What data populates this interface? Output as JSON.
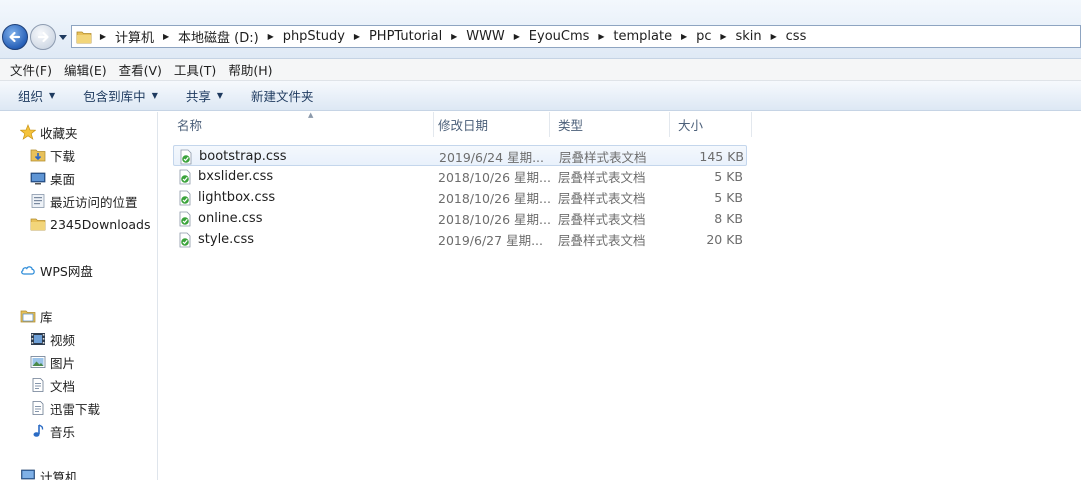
{
  "address_bar": {
    "crumbs": [
      "计算机",
      "本地磁盘 (D:)",
      "phpStudy",
      "PHPTutorial",
      "WWW",
      "EyouCms",
      "template",
      "pc",
      "skin",
      "css"
    ]
  },
  "menu": {
    "items": [
      "文件(F)",
      "编辑(E)",
      "查看(V)",
      "工具(T)",
      "帮助(H)"
    ]
  },
  "toolbar": {
    "organize": "组织",
    "include_library": "包含到库中",
    "share": "共享",
    "new_folder": "新建文件夹"
  },
  "nav": {
    "favorites": "收藏夹",
    "favorites_items": [
      "下载",
      "桌面",
      "最近访问的位置",
      "2345Downloads"
    ],
    "wps": "WPS网盘",
    "library": "库",
    "library_items": [
      "视频",
      "图片",
      "文档",
      "迅雷下载",
      "音乐"
    ],
    "computer": "计算机"
  },
  "columns": {
    "name": "名称",
    "date": "修改日期",
    "type": "类型",
    "size": "大小"
  },
  "files": [
    {
      "name": "bootstrap.css",
      "date": "2019/6/24 星期...",
      "type": "层叠样式表文档",
      "size": "145 KB",
      "selected": true
    },
    {
      "name": "bxslider.css",
      "date": "2018/10/26 星期...",
      "type": "层叠样式表文档",
      "size": "5 KB",
      "selected": false
    },
    {
      "name": "lightbox.css",
      "date": "2018/10/26 星期...",
      "type": "层叠样式表文档",
      "size": "5 KB",
      "selected": false
    },
    {
      "name": "online.css",
      "date": "2018/10/26 星期...",
      "type": "层叠样式表文档",
      "size": "8 KB",
      "selected": false
    },
    {
      "name": "style.css",
      "date": "2019/6/27 星期...",
      "type": "层叠样式表文档",
      "size": "20 KB",
      "selected": false
    }
  ],
  "colors": {
    "title_gradient_top": "#f3f8fd",
    "accent_blue": "#2760b8",
    "selection_border": "#c4d6ec",
    "muted_text": "#6d6d6d"
  }
}
